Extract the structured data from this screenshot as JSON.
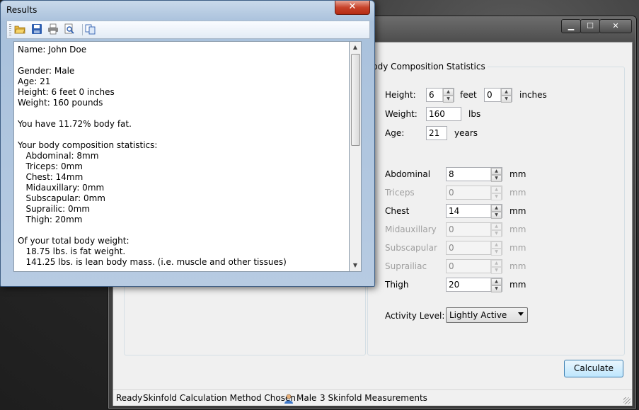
{
  "main_window": {
    "controls": {
      "minimize": "▁",
      "maximize": "☐",
      "close": "✕"
    },
    "group_title": "Body Composition Statistics",
    "height": {
      "label": "Height:",
      "feet_value": "6",
      "feet_label": "feet",
      "inches_value": "0",
      "inches_label": "inches"
    },
    "weight": {
      "label": "Weight:",
      "value": "160",
      "unit": "lbs"
    },
    "age": {
      "label": "Age:",
      "value": "21",
      "unit": "years"
    },
    "measurements": [
      {
        "label": "Abdominal",
        "value": "8",
        "unit": "mm",
        "enabled": true
      },
      {
        "label": "Triceps",
        "value": "0",
        "unit": "mm",
        "enabled": false
      },
      {
        "label": "Chest",
        "value": "14",
        "unit": "mm",
        "enabled": true
      },
      {
        "label": "Midauxillary",
        "value": "0",
        "unit": "mm",
        "enabled": false
      },
      {
        "label": "Subscapular",
        "value": "0",
        "unit": "mm",
        "enabled": false
      },
      {
        "label": "Suprailiac",
        "value": "0",
        "unit": "mm",
        "enabled": false
      },
      {
        "label": "Thigh",
        "value": "20",
        "unit": "mm",
        "enabled": true
      }
    ],
    "activity": {
      "label": "Activity Level:",
      "value": "Lightly Active"
    },
    "calculate_label": "Calculate",
    "status": {
      "ready": "Ready",
      "method": "Skinfold Calculation Method Chosen",
      "gender": "Male",
      "measurements": "3 Skinfold Measurements",
      "gender_icon": "user-icon"
    }
  },
  "results_window": {
    "title": "Results",
    "close": "✕",
    "toolbar_icons": [
      "open-folder-icon",
      "save-icon",
      "print-icon",
      "print-preview-icon",
      "copy-icon"
    ],
    "lines": [
      "Name: John Doe",
      "",
      "Gender: Male",
      "Age: 21",
      "Height: 6 feet 0 inches",
      "Weight: 160 pounds",
      "",
      "You have 11.72% body fat.",
      "",
      "Your body composition statistics:",
      "   Abdominal: 8mm",
      "   Triceps: 0mm",
      "   Chest: 14mm",
      "   Midauxillary: 0mm",
      "   Subscapular: 0mm",
      "   Suprailic: 0mm",
      "   Thigh: 20mm",
      "",
      "Of your total body weight:",
      "   18.75 lbs. is fat weight.",
      "   141.25 lbs. is lean body mass. (i.e. muscle and other tissues)"
    ]
  }
}
